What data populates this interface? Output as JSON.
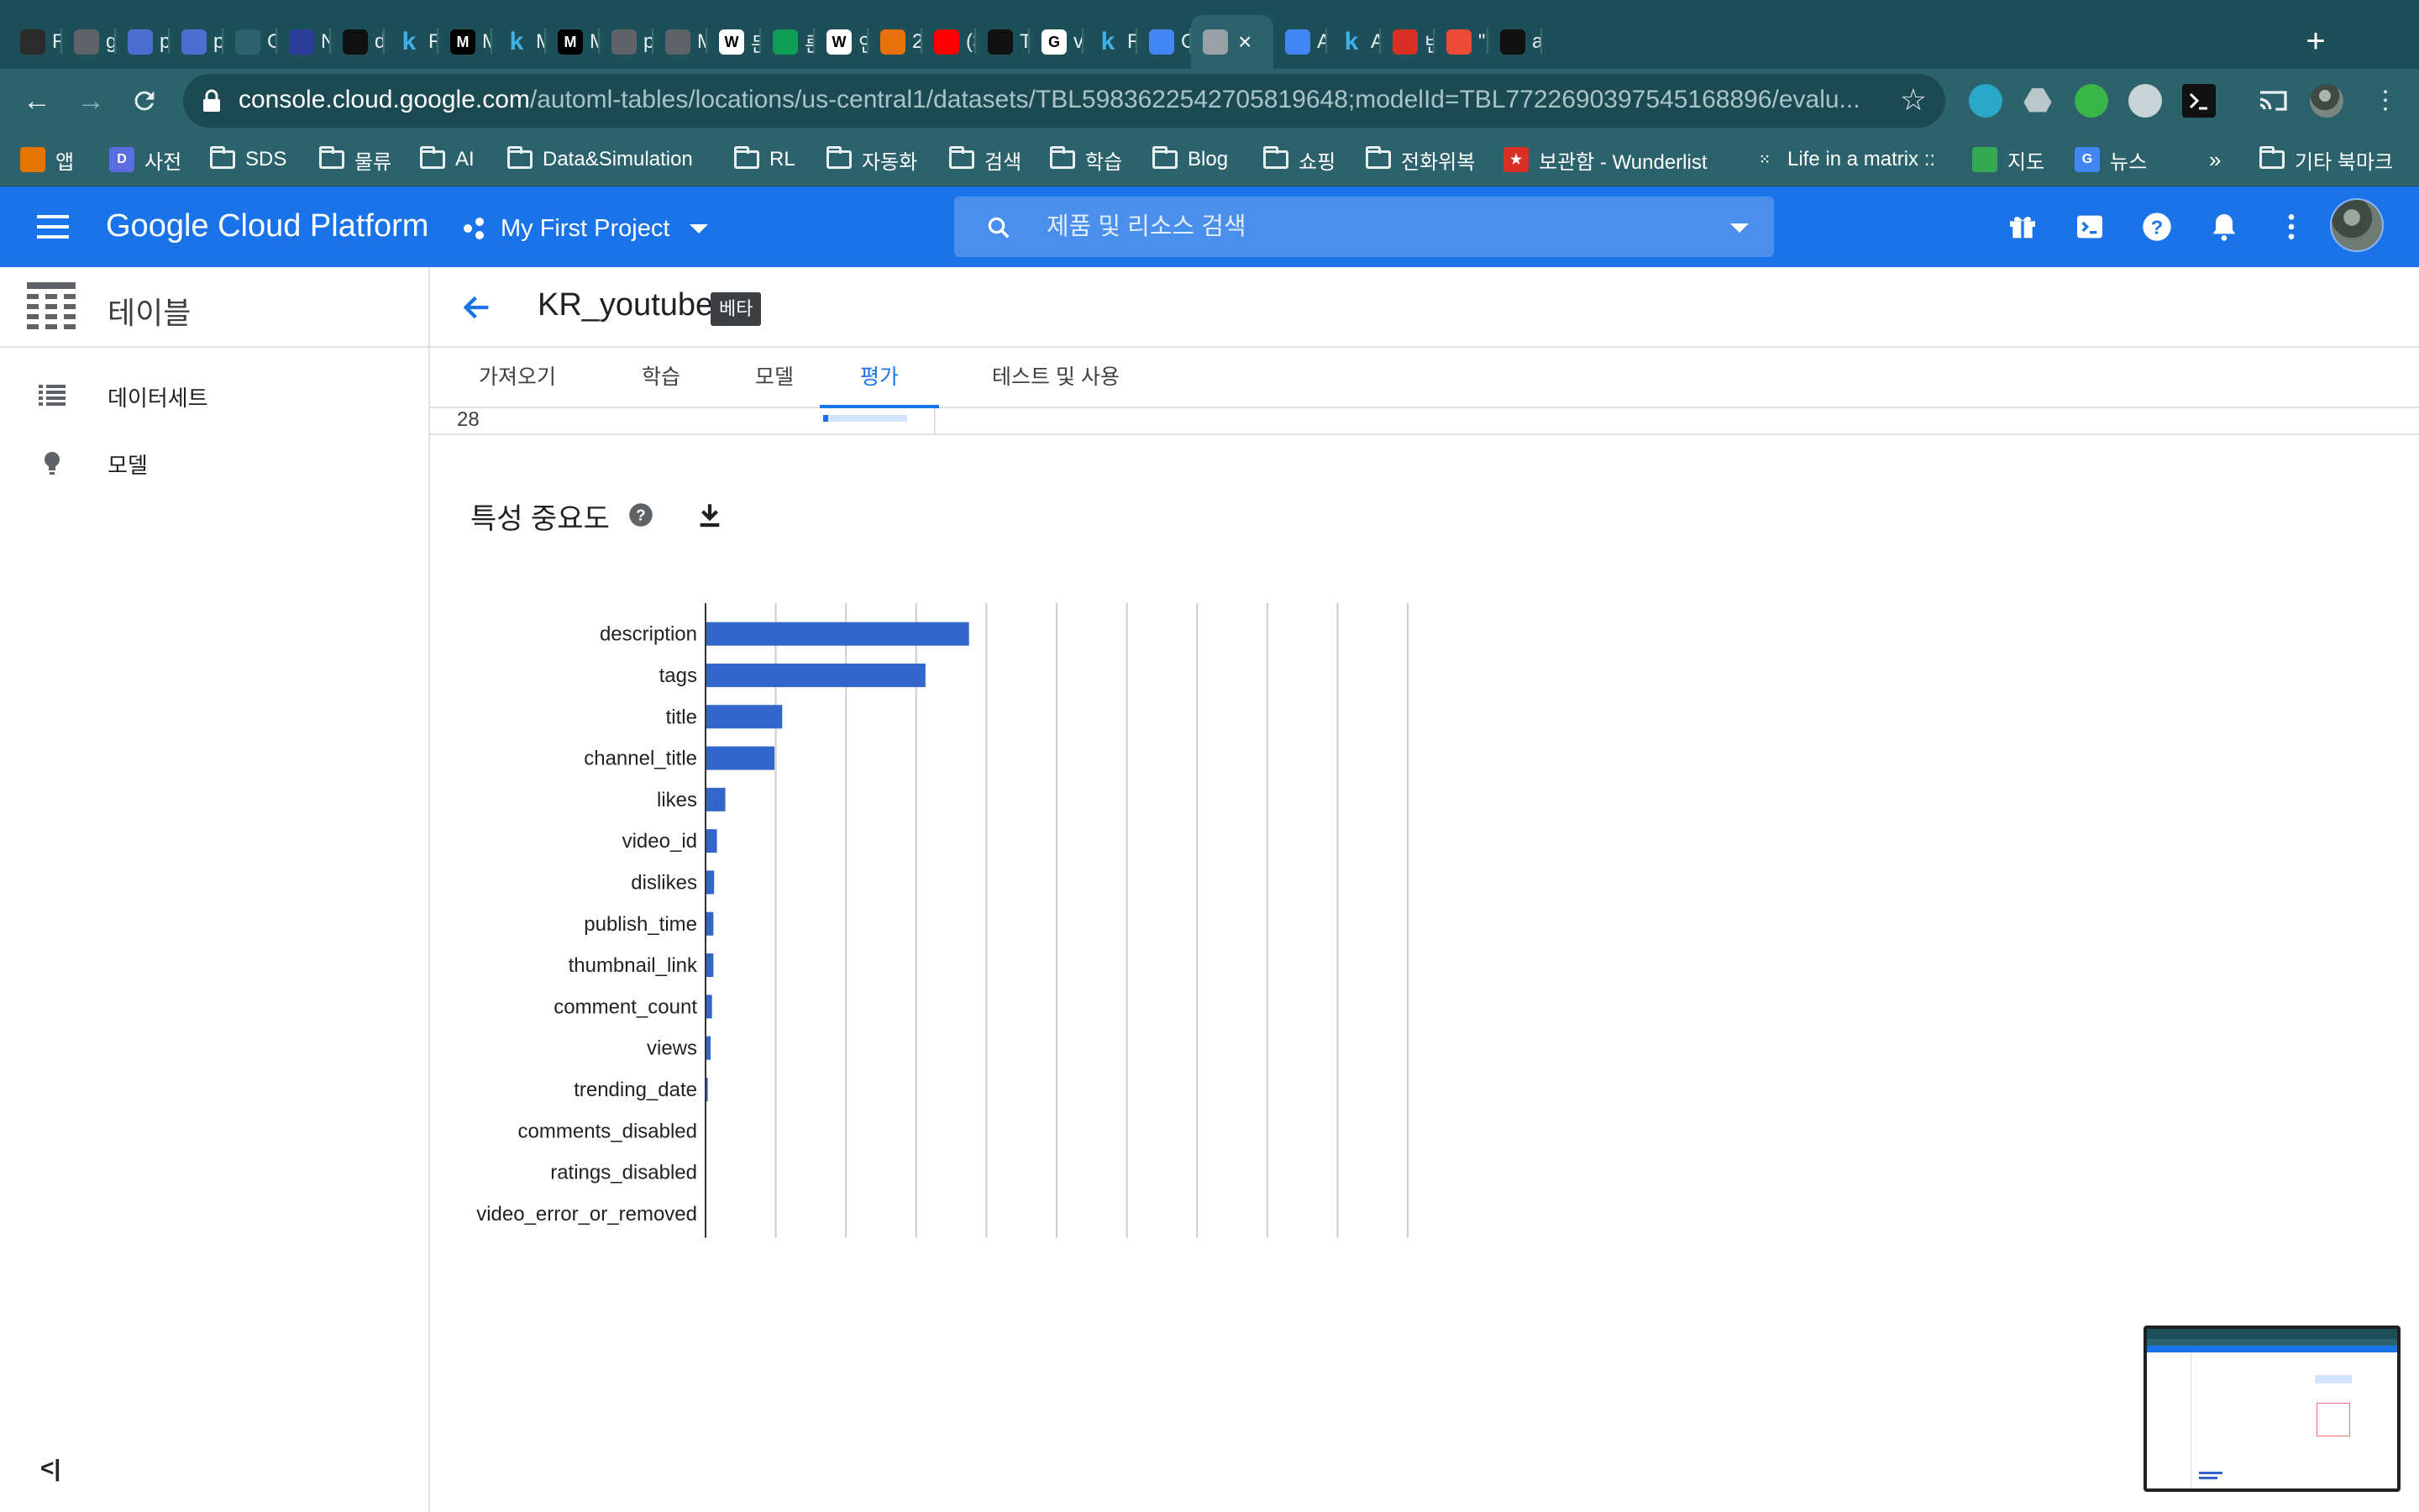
{
  "browser": {
    "tabs": [
      {
        "title": "R",
        "icon": "tinder-dots-icon",
        "color": "#2b2b2b"
      },
      {
        "title": "g",
        "icon": "globe-icon",
        "color": "#5f6368"
      },
      {
        "title": "p",
        "icon": "chat-bubble-icon",
        "color": "#4a6fd1"
      },
      {
        "title": "p",
        "icon": "chat-bubble-icon",
        "color": "#4a6fd1"
      },
      {
        "title": "G",
        "icon": "infinity-icon",
        "color": "#2c626b"
      },
      {
        "title": "N",
        "icon": "triangle-logo-icon",
        "color": "#2c3e9a"
      },
      {
        "title": "d",
        "icon": "github-icon",
        "color": "#111111"
      },
      {
        "title": "R",
        "icon": "k-logo-icon",
        "color": "#2c626b"
      },
      {
        "title": "M",
        "icon": "medium-icon",
        "color": "#000000"
      },
      {
        "title": "M",
        "icon": "k-logo-icon",
        "color": "#2c626b"
      },
      {
        "title": "M",
        "icon": "medium-icon",
        "color": "#000000"
      },
      {
        "title": "p",
        "icon": "globe-icon",
        "color": "#5f6368"
      },
      {
        "title": "M",
        "icon": "globe-icon",
        "color": "#5f6368"
      },
      {
        "title": "든",
        "icon": "wikipedia-icon",
        "color": "#ffffff"
      },
      {
        "title": "른",
        "icon": "green-logo-icon",
        "color": "#0f9d58"
      },
      {
        "title": "인",
        "icon": "wikipedia-icon",
        "color": "#ffffff"
      },
      {
        "title": "2",
        "icon": "sun-icon",
        "color": "#e8710a"
      },
      {
        "title": "(3",
        "icon": "youtube-icon",
        "color": "#ff0000"
      },
      {
        "title": "T",
        "icon": "github-icon",
        "color": "#111111"
      },
      {
        "title": "vi",
        "icon": "google-icon",
        "color": "#ffffff"
      },
      {
        "title": "R",
        "icon": "k-logo-icon",
        "color": "#2c626b"
      },
      {
        "title": "C",
        "icon": "gcloud-icon",
        "color": "#4285f4"
      },
      {
        "title": "",
        "icon": "automl-icon",
        "color": "#9aa0a6",
        "active": true
      },
      {
        "title": "A",
        "icon": "gcloud-icon",
        "color": "#4285f4"
      },
      {
        "title": "A",
        "icon": "k-logo-icon",
        "color": "#2c626b"
      },
      {
        "title": "빈",
        "icon": "gmail-icon",
        "color": "#d93025"
      },
      {
        "title": "\"I",
        "icon": "it-logo-icon",
        "color": "#e94b35"
      },
      {
        "title": "a",
        "icon": "github-icon",
        "color": "#111111"
      }
    ],
    "url_host": "console.cloud.google.com",
    "url_path": "/automl-tables/locations/us-central1/datasets/TBL5983622542705819648;modelId=TBL7722690397545168896/evalu...",
    "bookmarks": [
      {
        "label": "앱",
        "icon": "apps-grid-icon"
      },
      {
        "label": "사전",
        "icon": "d-logo-icon"
      },
      {
        "label": "SDS",
        "icon": "folder-icon"
      },
      {
        "label": "물류",
        "icon": "folder-icon"
      },
      {
        "label": "AI",
        "icon": "folder-icon"
      },
      {
        "label": "Data&Simulation",
        "icon": "folder-icon"
      },
      {
        "label": "RL",
        "icon": "folder-icon"
      },
      {
        "label": "자동화",
        "icon": "folder-icon"
      },
      {
        "label": "검색",
        "icon": "folder-icon"
      },
      {
        "label": "학습",
        "icon": "folder-icon"
      },
      {
        "label": "Blog",
        "icon": "folder-icon"
      },
      {
        "label": "쇼핑",
        "icon": "folder-icon"
      },
      {
        "label": "전화위복",
        "icon": "folder-icon"
      },
      {
        "label": "보관함 - Wunderlist",
        "icon": "wunderlist-icon"
      },
      {
        "label": "Life in a matrix ::",
        "icon": "tinder-dots-icon"
      },
      {
        "label": "지도",
        "icon": "maps-icon"
      },
      {
        "label": "뉴스",
        "icon": "news-icon"
      }
    ],
    "bookmarks_more": "»",
    "other_bookmarks": "기타 북마크"
  },
  "header": {
    "product": "Google Cloud Platform",
    "project": "My First Project",
    "search_placeholder": "제품 및 리소스 검색"
  },
  "sidebar": {
    "title": "테이블",
    "items": [
      {
        "label": "데이터세트",
        "icon": "list-icon"
      },
      {
        "label": "모델",
        "icon": "lightbulb-icon"
      }
    ],
    "collapse": "<|"
  },
  "main": {
    "dataset_title": "KR_youtube",
    "badge": "베타",
    "tabs": [
      {
        "label": "가져오기"
      },
      {
        "label": "학습"
      },
      {
        "label": "모델"
      },
      {
        "label": "평가",
        "active": true
      },
      {
        "label": "테스트 및 사용"
      }
    ],
    "prev_row_value": "28",
    "section_title": "특성 중요도"
  },
  "chart_data": {
    "type": "bar",
    "orientation": "horizontal",
    "categories": [
      "description",
      "tags",
      "title",
      "channel_title",
      "likes",
      "video_id",
      "dislikes",
      "publish_time",
      "thumbnail_link",
      "comment_count",
      "views",
      "trending_date",
      "comments_disabled",
      "ratings_disabled",
      "video_error_or_removed"
    ],
    "values": [
      37.4,
      31.2,
      10.8,
      9.7,
      2.7,
      1.5,
      1.1,
      1.0,
      1.0,
      0.8,
      0.6,
      0.2,
      0.0,
      0.0,
      0.0
    ],
    "xlim": [
      0,
      100
    ],
    "xticks": [
      "0%",
      "20%",
      "40%",
      "60%",
      "80%",
      "100%"
    ],
    "grid": true,
    "bar_color": "#3366cc"
  }
}
